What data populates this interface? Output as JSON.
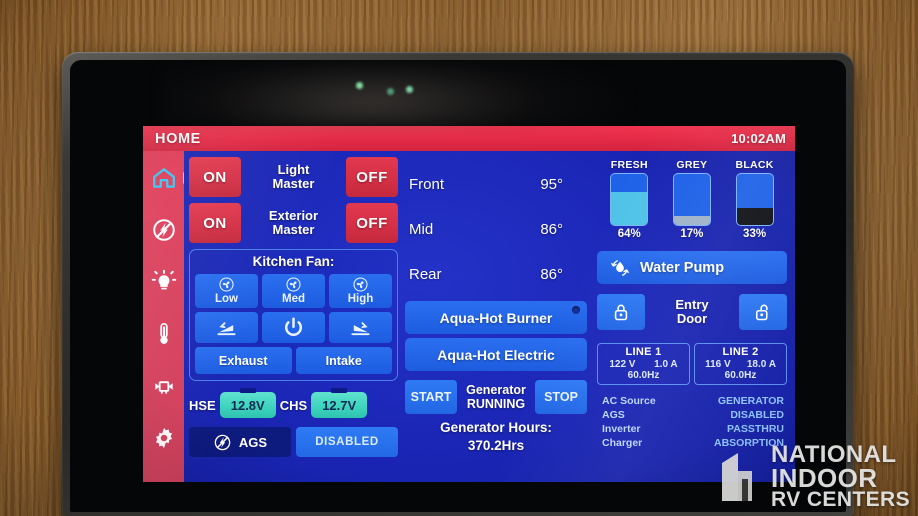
{
  "header": {
    "title": "HOME",
    "clock": "10:02AM"
  },
  "sidebar": {
    "items": [
      {
        "name": "home",
        "icon": "home-icon",
        "active": true
      },
      {
        "name": "power",
        "icon": "ags-power-icon",
        "active": false
      },
      {
        "name": "lighting",
        "icon": "light-bulb-icon",
        "active": false
      },
      {
        "name": "climate",
        "icon": "thermometer-icon",
        "active": false
      },
      {
        "name": "tanks",
        "icon": "tank-icon",
        "active": false
      },
      {
        "name": "settings",
        "icon": "gear-icon",
        "active": false
      }
    ]
  },
  "lighting": {
    "masters": [
      {
        "label": "Light Master",
        "on": "ON",
        "off": "OFF"
      },
      {
        "label": "Exterior Master",
        "on": "ON",
        "off": "OFF"
      }
    ]
  },
  "kitchen_fan": {
    "title": "Kitchen Fan:",
    "speeds": [
      {
        "label": "Low",
        "icon": "fan-icon"
      },
      {
        "label": "Med",
        "icon": "fan-icon"
      },
      {
        "label": "High",
        "icon": "fan-icon"
      }
    ],
    "controls": [
      {
        "icon": "vent-open-icon"
      },
      {
        "icon": "power-icon"
      },
      {
        "icon": "vent-close-icon"
      }
    ],
    "direction": [
      "Exhaust",
      "Intake"
    ]
  },
  "batteries": [
    {
      "label": "HSE",
      "voltage": "12.8V"
    },
    {
      "label": "CHS",
      "voltage": "12.7V"
    }
  ],
  "ags": {
    "label": "AGS",
    "icon": "ags-power-icon",
    "state": "DISABLED"
  },
  "temperatures": [
    {
      "zone": "Front",
      "value": "95°"
    },
    {
      "zone": "Mid",
      "value": "86°"
    },
    {
      "zone": "Rear",
      "value": "86°"
    }
  ],
  "aqua_hot": [
    {
      "label": "Aqua-Hot Burner",
      "has_indicator": true
    },
    {
      "label": "Aqua-Hot Electric",
      "has_indicator": false
    }
  ],
  "generator": {
    "start_label": "START",
    "stop_label": "STOP",
    "name": "Generator",
    "state": "RUNNING",
    "hours_label": "Generator Hours:",
    "hours_value": "370.2Hrs"
  },
  "tanks": [
    {
      "name": "FRESH",
      "percent": "64%",
      "level": 64,
      "color": "#4fc3e8"
    },
    {
      "name": "GREY",
      "percent": "17%",
      "level": 17,
      "color": "#9fb3c8"
    },
    {
      "name": "BLACK",
      "percent": "33%",
      "level": 33,
      "color": "#111318"
    }
  ],
  "water_pump": {
    "label": "Water Pump",
    "icon": "water-drop-icon"
  },
  "entry_door": {
    "label_line1": "Entry",
    "label_line2": "Door",
    "lock_icon": "lock-closed-icon",
    "unlock_icon": "lock-open-icon"
  },
  "power_lines": [
    {
      "name": "LINE 1",
      "volts": "122 V",
      "amps": "1.0 A",
      "hz": "60.0Hz"
    },
    {
      "name": "LINE 2",
      "volts": "116 V",
      "amps": "18.0 A",
      "hz": "60.0Hz"
    }
  ],
  "power_status": [
    {
      "key": "AC Source",
      "value": "GENERATOR"
    },
    {
      "key": "AGS",
      "value": "DISABLED"
    },
    {
      "key": "Inverter",
      "value": "PASSTHRU"
    },
    {
      "key": "Charger",
      "value": "ABSORPTION"
    }
  ],
  "watermark": {
    "line1": "NATIONAL",
    "line2": "INDOOR",
    "line3": "RV CENTERS"
  }
}
